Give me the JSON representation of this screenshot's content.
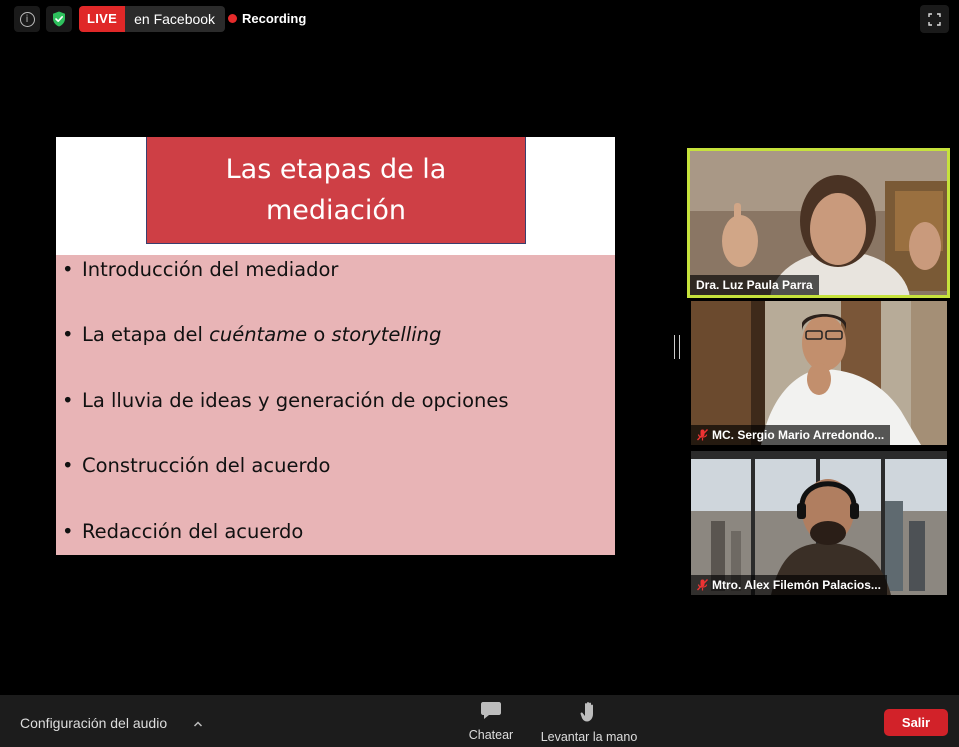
{
  "topbar": {
    "info_icon": "info-icon",
    "shield_icon": "shield-check-icon",
    "live_badge": "LIVE",
    "live_target": "en Facebook",
    "recording_label": "Recording",
    "fullscreen_icon": "fullscreen-icon"
  },
  "slide": {
    "title": "Las etapas de la mediación",
    "bullets": [
      {
        "text": "Introducción del mediador"
      },
      {
        "pre": "La etapa del ",
        "em1": "cuéntame",
        "mid": " o ",
        "em2": "storytelling"
      },
      {
        "text": "La lluvia de ideas y generación de opciones"
      },
      {
        "text": "Construcción del acuerdo"
      },
      {
        "text": "Redacción del acuerdo"
      }
    ]
  },
  "participants": [
    {
      "name": "Dra. Luz Paula Parra",
      "muted": false,
      "active_speaker": true
    },
    {
      "name": "MC. Sergio Mario Arredondo...",
      "muted": true
    },
    {
      "name": "Mtro. Alex Filemón Palacios...",
      "muted": true
    }
  ],
  "toolbar": {
    "audio_config": "Configuración del audio",
    "chat": "Chatear",
    "raise_hand": "Levantar la mano",
    "leave": "Salir"
  },
  "colors": {
    "live_red": "#e02828",
    "recording_dot": "#e52b2b",
    "leave_red": "#d22229",
    "active_speaker_border": "#c6e23c",
    "slide_title_bg": "#ce3f45",
    "slide_body_bg": "#e8b4b6"
  }
}
